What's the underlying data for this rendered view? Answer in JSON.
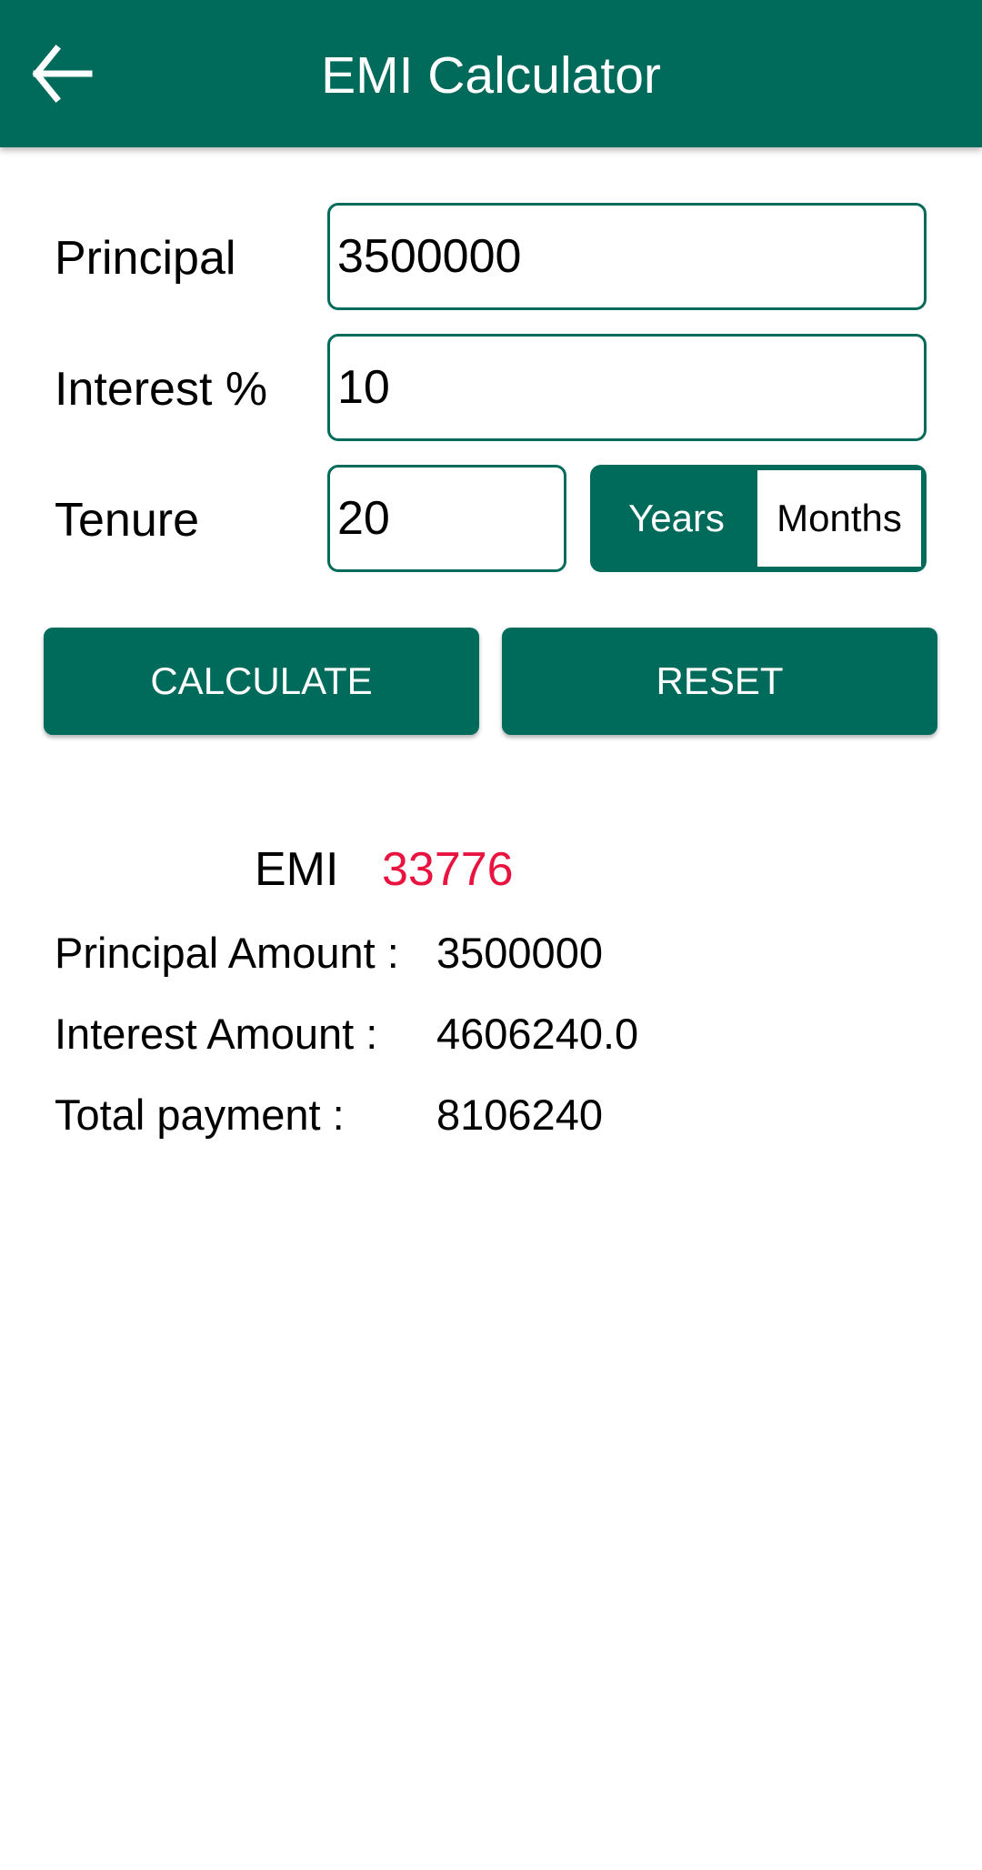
{
  "app": {
    "title": "EMI Calculator",
    "back_icon": "arrow-left-icon",
    "colors": {
      "primary": "#006A5B",
      "emi_value": "#E8133E"
    }
  },
  "form": {
    "principal": {
      "label": "Principal",
      "value": "3500000"
    },
    "interest": {
      "label": "Interest %",
      "value": "10"
    },
    "tenure": {
      "label": "Tenure",
      "value": "20"
    },
    "tenure_unit": {
      "options": [
        "Years",
        "Months"
      ],
      "selected": "Years"
    }
  },
  "buttons": {
    "calculate": "CALCULATE",
    "reset": "RESET"
  },
  "result": {
    "emi_label": "EMI",
    "emi_value": "33776",
    "rows": [
      {
        "label": "Principal Amount :",
        "value": "3500000"
      },
      {
        "label": "Interest Amount :",
        "value": "4606240.0"
      },
      {
        "label": "Total payment :",
        "value": "8106240"
      }
    ]
  }
}
